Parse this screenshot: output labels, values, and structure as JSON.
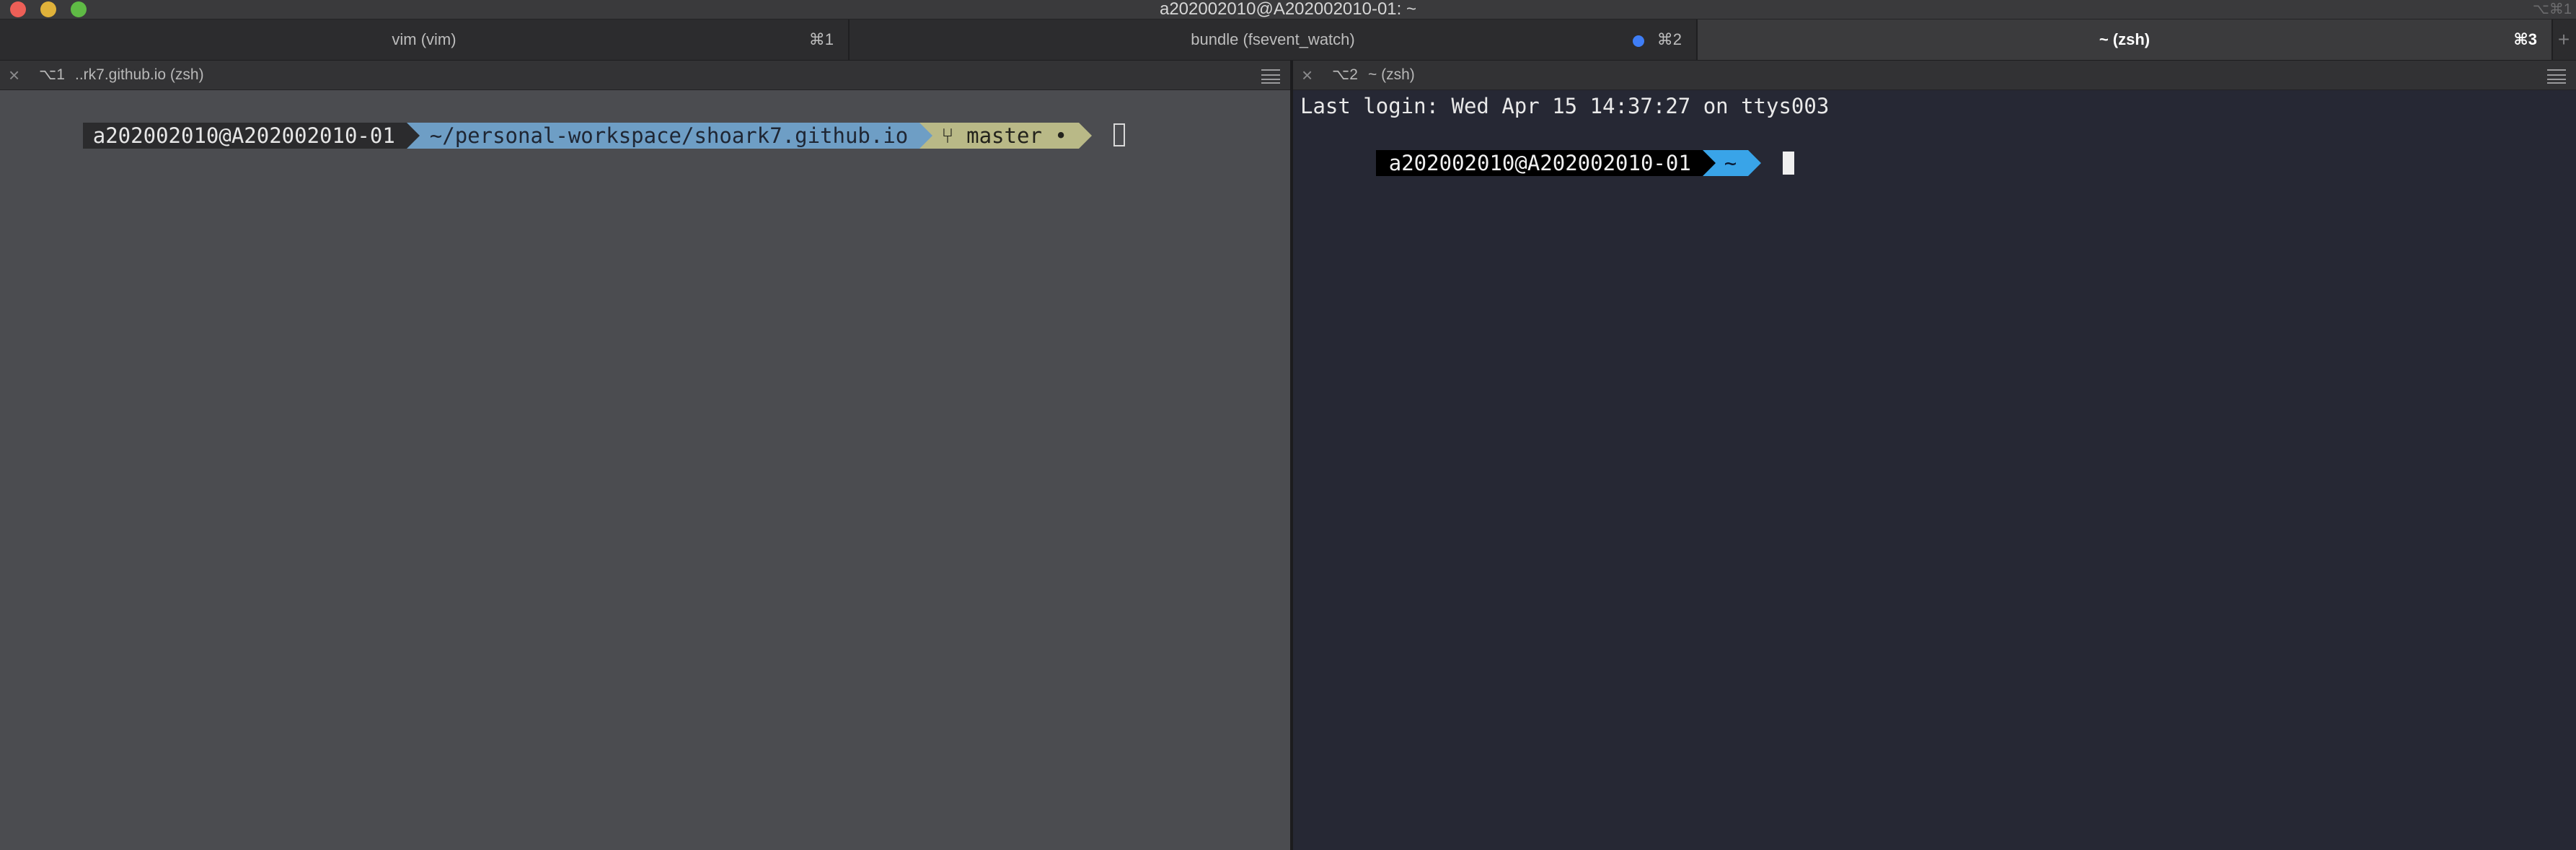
{
  "window": {
    "title": "a202002010@A202002010-01: ~",
    "shortcut_hint": "⌥⌘1"
  },
  "tabs": [
    {
      "label": "vim (vim)",
      "shortcut": "⌘1",
      "active": false
    },
    {
      "label": "bundle (fsevent_watch)",
      "shortcut": "⌘2",
      "active": false,
      "activity": true
    },
    {
      "label": "~ (zsh)",
      "shortcut": "⌘3",
      "active": true
    }
  ],
  "new_tab_glyph": "+",
  "left_pane": {
    "shortcut": "⌥1",
    "title": "..rk7.github.io (zsh)",
    "prompt": {
      "context": "a202002010@A202002010-01",
      "directory": "~/personal-workspace/shoark7.github.io",
      "git_icon": "⑂",
      "git_branch": "master",
      "git_status": "•"
    }
  },
  "right_pane": {
    "shortcut": "⌥2",
    "title": "~ (zsh)",
    "last_login": "Last login: Wed Apr 15 14:37:27 on ttys003",
    "prompt": {
      "context": "a202002010@A202002010-01",
      "directory": "~"
    }
  },
  "colors": {
    "left_bg": "#4b4c50",
    "right_bg": "#262834",
    "dir_segment": "#6e9ec5",
    "git_segment": "#b9b987",
    "home_segment": "#39a4e8",
    "activity_dot": "#3f7ef7"
  }
}
